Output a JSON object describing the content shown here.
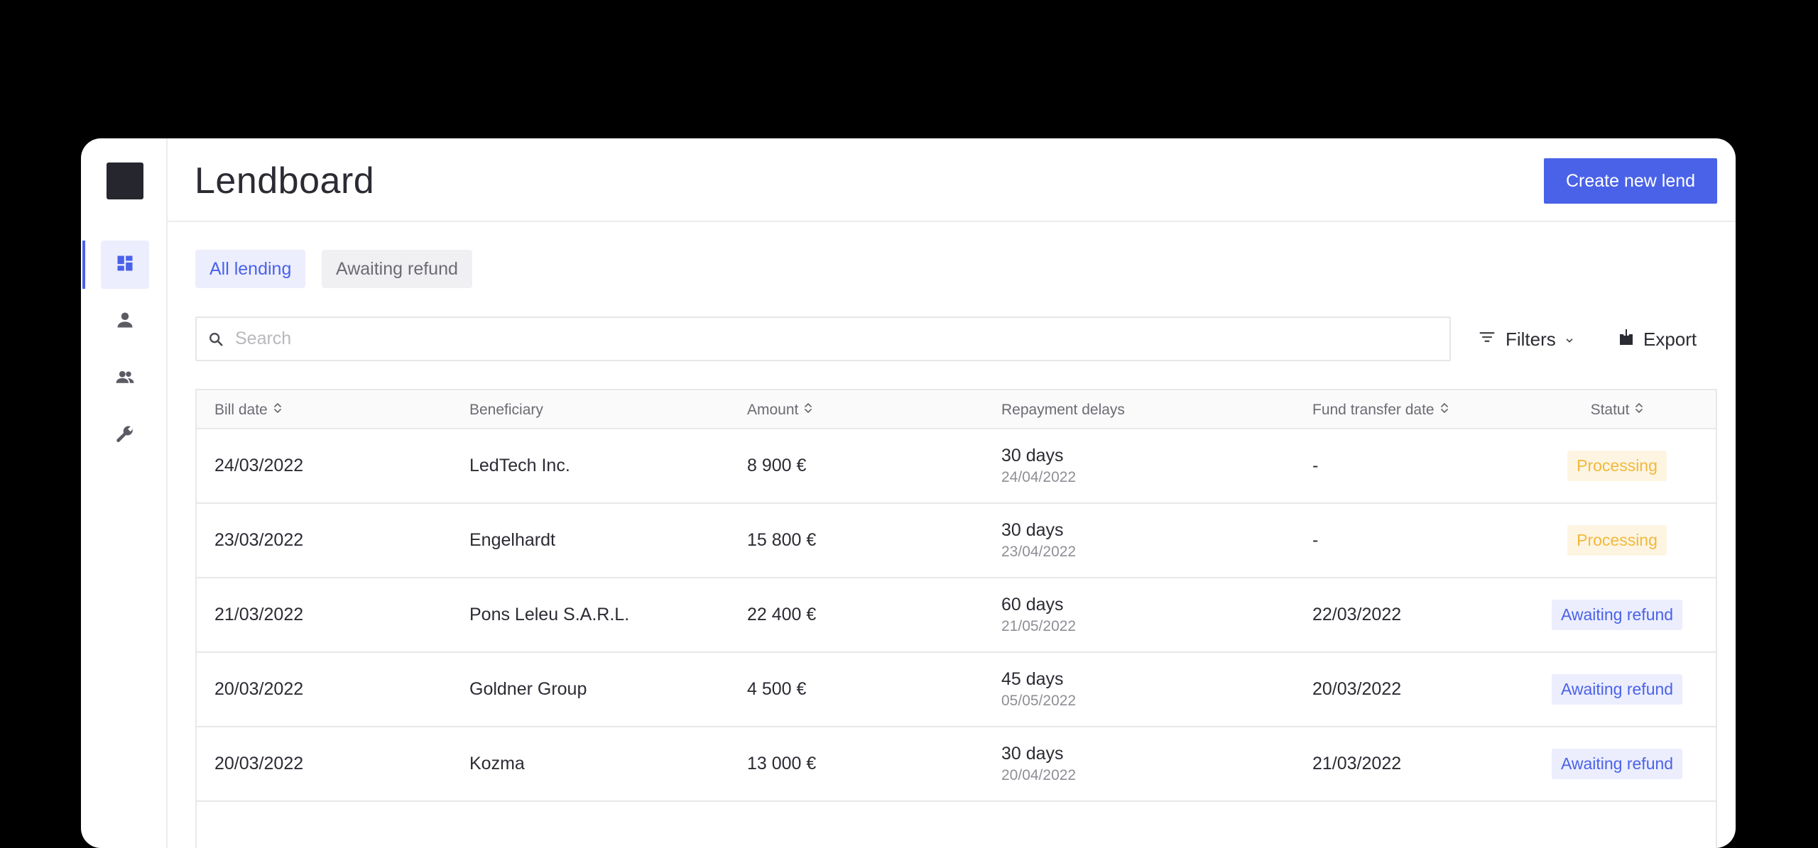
{
  "app": {
    "title": "Lendboard"
  },
  "header": {
    "create_label": "Create new lend"
  },
  "sidebar": {
    "items": [
      {
        "icon": "dashboard-icon",
        "active": true
      },
      {
        "icon": "user-icon",
        "active": false
      },
      {
        "icon": "users-icon",
        "active": false
      },
      {
        "icon": "wrench-icon",
        "active": false
      }
    ]
  },
  "tabs": [
    {
      "label": "All lending",
      "active": true
    },
    {
      "label": "Awaiting refund",
      "active": false
    }
  ],
  "toolbar": {
    "search_placeholder": "Search",
    "filters_label": "Filters",
    "export_label": "Export"
  },
  "table": {
    "columns": [
      {
        "label": "Bill date",
        "sortable": true
      },
      {
        "label": "Beneficiary",
        "sortable": false
      },
      {
        "label": "Amount",
        "sortable": true
      },
      {
        "label": "Repayment delays",
        "sortable": false
      },
      {
        "label": "Fund transfer date",
        "sortable": true
      },
      {
        "label": "Statut",
        "sortable": true
      }
    ],
    "rows": [
      {
        "bill_date": "24/03/2022",
        "beneficiary": "LedTech Inc.",
        "amount": "8 900 €",
        "delay": "30 days",
        "delay_date": "24/04/2022",
        "transfer_date": "-",
        "status": "Processing",
        "status_type": "processing"
      },
      {
        "bill_date": "23/03/2022",
        "beneficiary": "Engelhardt",
        "amount": "15 800 €",
        "delay": "30 days",
        "delay_date": "23/04/2022",
        "transfer_date": "-",
        "status": "Processing",
        "status_type": "processing"
      },
      {
        "bill_date": "21/03/2022",
        "beneficiary": "Pons Leleu S.A.R.L.",
        "amount": "22 400 €",
        "delay": "60 days",
        "delay_date": "21/05/2022",
        "transfer_date": "22/03/2022",
        "status": "Awaiting refund",
        "status_type": "awaiting"
      },
      {
        "bill_date": "20/03/2022",
        "beneficiary": "Goldner Group",
        "amount": "4 500 €",
        "delay": "45 days",
        "delay_date": "05/05/2022",
        "transfer_date": "20/03/2022",
        "status": "Awaiting refund",
        "status_type": "awaiting"
      },
      {
        "bill_date": "20/03/2022",
        "beneficiary": "Kozma",
        "amount": "13 000 €",
        "delay": "30 days",
        "delay_date": "20/04/2022",
        "transfer_date": "21/03/2022",
        "status": "Awaiting refund",
        "status_type": "awaiting"
      }
    ]
  },
  "colors": {
    "accent": "#4a62e8",
    "processing_text": "#f2b83c",
    "processing_bg": "#fdf5e2",
    "awaiting_bg": "#eceefe"
  }
}
